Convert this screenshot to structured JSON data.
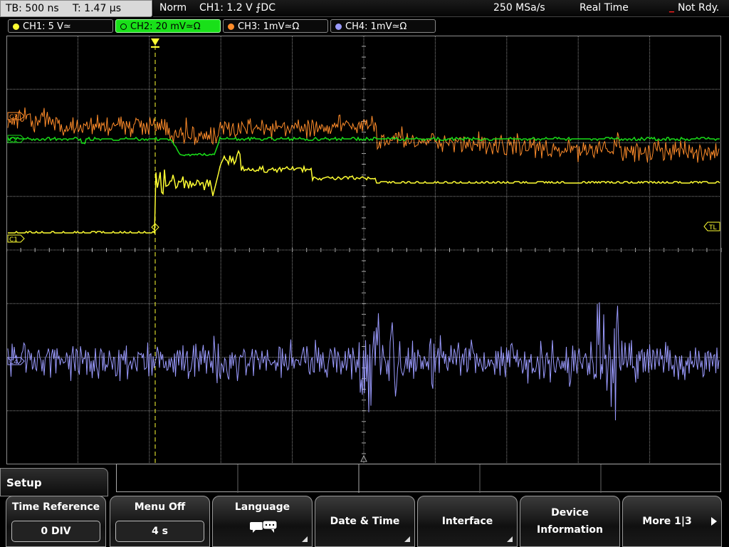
{
  "status": {
    "timebase": "TB: 500 ns",
    "trigger_time": "T: 1.47 µs",
    "mode": "Norm",
    "trigger": "CH1: 1.2 V ⨍DC",
    "sample_rate": "250 MSa/s",
    "acquisition": "Real Time",
    "state": "Not Rdy."
  },
  "channels": [
    {
      "label": "CH1: 5 V≃",
      "color": "#ffff33"
    },
    {
      "label": "CH2: 20 mV≃Ω",
      "color": "#19e019",
      "active": true
    },
    {
      "label": "CH3: 1mV≃Ω",
      "color": "#ff8c2a"
    },
    {
      "label": "CH4: 1mV≃Ω",
      "color": "#9b9bff"
    }
  ],
  "markers": {
    "c3": "C3",
    "c2": "C2",
    "c1": "C1",
    "c4": "C4",
    "tl": "TL"
  },
  "colors": {
    "grid": "#8c8c8c",
    "trigger_marker": "#ffff33",
    "ch1": "#ffff33",
    "ch2": "#19e019",
    "ch3": "#ff8c2a",
    "ch4": "#9b9bff"
  },
  "menu": {
    "title": "Setup",
    "softkeys": [
      {
        "label": "Time Reference",
        "value": "0 DIV"
      },
      {
        "label": "Menu Off",
        "value": "4 s"
      },
      {
        "label": "Language",
        "icon": "speech-bubbles-icon"
      },
      {
        "label": "Date & Time"
      },
      {
        "label": "Interface"
      },
      {
        "label_line1": "Device",
        "label_line2": "Information"
      },
      {
        "label": "More 1|3",
        "icon": "right-arrow-icon"
      }
    ]
  }
}
